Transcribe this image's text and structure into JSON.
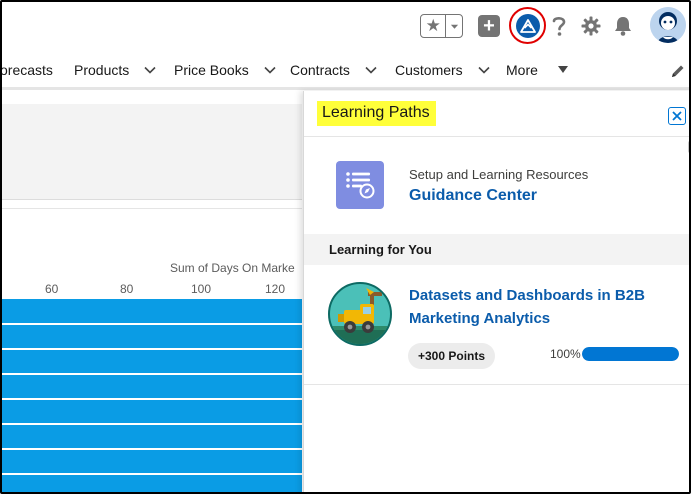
{
  "nav": {
    "items": [
      {
        "label": "orecasts"
      },
      {
        "label": "Products"
      },
      {
        "label": "Price Books"
      },
      {
        "label": "Contracts"
      },
      {
        "label": "Customers"
      },
      {
        "label": "More"
      }
    ]
  },
  "chart": {
    "axis_title": "Sum of Days On Marke",
    "ticks": [
      "60",
      "80",
      "100",
      "120"
    ]
  },
  "panel": {
    "title": "Learning Paths",
    "guidance": {
      "subtitle": "Setup and Learning Resources",
      "link": "Guidance Center"
    },
    "section_label": "Learning for You",
    "course": {
      "title": "Datasets and Dashboards in B2B Marketing Analytics",
      "points": "+300 Points",
      "progress_label": "100%",
      "progress": 1.0
    }
  },
  "colors": {
    "highlight": "#ffff3a",
    "link": "#0b5cab",
    "bar": "#0a9ce5",
    "focus_ring": "#e00000"
  }
}
